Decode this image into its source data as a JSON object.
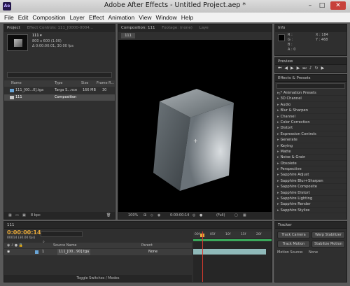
{
  "window": {
    "title": "Adobe After Effects - Untitled Project.aep *",
    "app_icon": "Ae",
    "minimize": "–",
    "maximize": "□",
    "close": "✕"
  },
  "menu": [
    "File",
    "Edit",
    "Composition",
    "Layer",
    "Effect",
    "Animation",
    "View",
    "Window",
    "Help"
  ],
  "project": {
    "tab": "Project",
    "effect_controls_tab": "Effect Controls: 111_[0000-0004...",
    "comp_name": "111 ▾",
    "info_line1": "800 x 600 (1.00)",
    "info_line2": "Δ 0:00:00:01, 30.00 fps",
    "search_placeholder": "⌕",
    "columns": [
      "Name",
      "Type",
      "Size",
      "Frame R..."
    ],
    "items": [
      {
        "name": "111_[00...0].tga",
        "type": "Targa S...nce",
        "size": "166 MB",
        "frame": "30"
      },
      {
        "name": "111",
        "type": "Composition",
        "size": "",
        "frame": ""
      }
    ],
    "bpc": "8 bpc"
  },
  "composition": {
    "tab": "Composition: 111",
    "footage_tab": "Footage: (none)",
    "layer_tab": "Laye",
    "comp_chip": "111",
    "zoom": "100%",
    "timecode": "0:00:00:14",
    "resolution": "(Full)"
  },
  "info": {
    "tab": "Info",
    "r": "R :",
    "g": "G :",
    "b": "B :",
    "a": "A : 0",
    "x": "X : 184",
    "y": "Y : 468"
  },
  "preview": {
    "tab": "Preview"
  },
  "effects": {
    "tab": "Effects & Presets",
    "search_placeholder": "⌕",
    "items": [
      "* Animation Presets",
      "3D Channel",
      "Audio",
      "Blur & Sharpen",
      "Channel",
      "Color Correction",
      "Distort",
      "Expression Controls",
      "Generate",
      "Keying",
      "Matte",
      "Noise & Grain",
      "Obsolete",
      "Perspective",
      "Sapphire Adjust",
      "Sapphire Blur+Sharpen",
      "Sapphire Composite",
      "Sapphire Distort",
      "Sapphire Lighting",
      "Sapphire Render",
      "Sapphire Stylize"
    ]
  },
  "timeline": {
    "tab": "111",
    "timecode": "0:00:00:14",
    "fps": "00014 (30.00 fps)",
    "search_placeholder": "⌕",
    "columns": {
      "source": "Source Name",
      "parent": "Parent"
    },
    "layer": {
      "index": "1",
      "name": "111_[00...90].tga",
      "parent": "None"
    },
    "footer": "Toggle Switches / Modes",
    "ruler": [
      "00f",
      "05f",
      "10f",
      "15f",
      "20f"
    ]
  },
  "tracker": {
    "tab": "Tracker",
    "track_camera": "Track Camera",
    "warp_stabilizer": "Warp Stabilizer",
    "track_motion": "Track Motion",
    "stabilize_motion": "Stabilize Motion",
    "motion_source": "Motion Source:",
    "motion_value": "None"
  }
}
